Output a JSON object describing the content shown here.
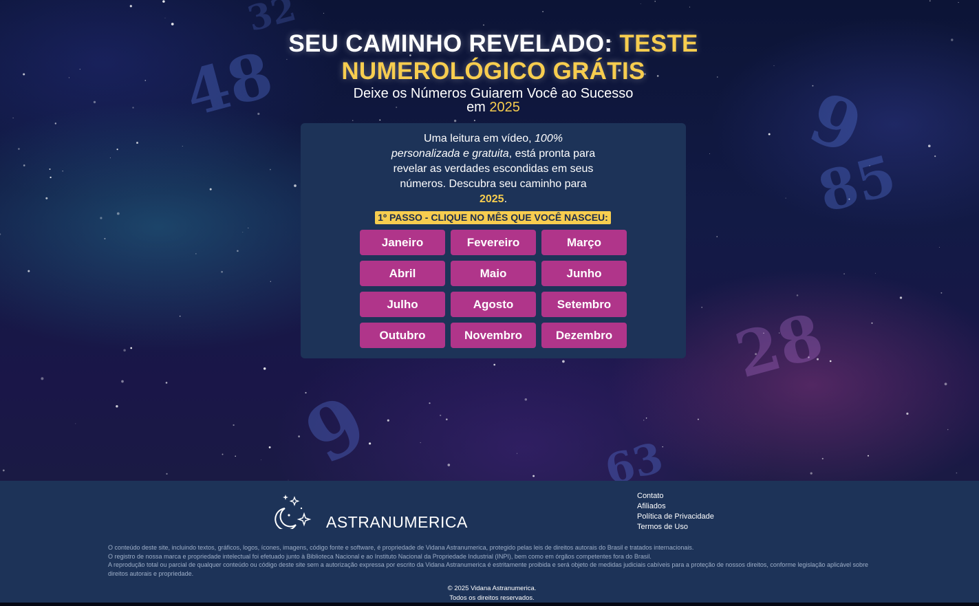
{
  "hero": {
    "headline_white": "SEU CAMINHO REVELADO:",
    "headline_yellow": "TESTE NUMEROLÓGICO GRÁTIS",
    "subhead_line1": "Deixe os Números Guiarem Você ao Sucesso",
    "subhead_em": "em",
    "subhead_year": "2025"
  },
  "card": {
    "intro_part1": "Uma leitura em vídeo,",
    "intro_em": "100% personalizada e gratuita",
    "intro_part2": ", está pronta para revelar as verdades escondidas em seus números. Descubra seu caminho para",
    "intro_year": "2025",
    "intro_end": ".",
    "step_label": "1º PASSO - CLIQUE NO MÊS QUE VOCÊ NASCEU:",
    "months": [
      "Janeiro",
      "Fevereiro",
      "Março",
      "Abril",
      "Maio",
      "Junho",
      "Julho",
      "Agosto",
      "Setembro",
      "Outubro",
      "Novembro",
      "Dezembro"
    ]
  },
  "footer": {
    "logo_text": "ASTRANUMERICA",
    "logo_icon": "moon-stars-icon",
    "links": [
      "Contato",
      "Afiliados",
      "Política de Privacidade",
      "Termos de Uso"
    ],
    "legal": [
      "O conteúdo deste site, incluindo textos, gráficos, logos, ícones, imagens, código fonte e software, é propriedade de Vidana Astranumerica, protegido pelas leis de direitos autorais do Brasil e tratados internacionais.",
      "O registro de nossa marca e propriedade intelectual foi efetuado junto à Biblioteca Nacional e ao Instituto Nacional da Propriedade Industrial (INPI), bem como em órgãos competentes fora do Brasil.",
      "A reprodução total ou parcial de qualquer conteúdo ou código deste site sem a autorização expressa por escrito da Vidana Astranumerica é estritamente proibida e será objeto de medidas judiciais cabíveis para a proteção de nossos direitos, conforme legislação aplicável sobre direitos autorais e propriedade."
    ],
    "copyright_line1": "© 2025 Vidana Astranumerica.",
    "copyright_line2": "Todos os direitos reservados."
  },
  "colors": {
    "accent_yellow": "#f7cd4f",
    "button_magenta": "#b0358a",
    "card_navy": "#1d3358"
  }
}
